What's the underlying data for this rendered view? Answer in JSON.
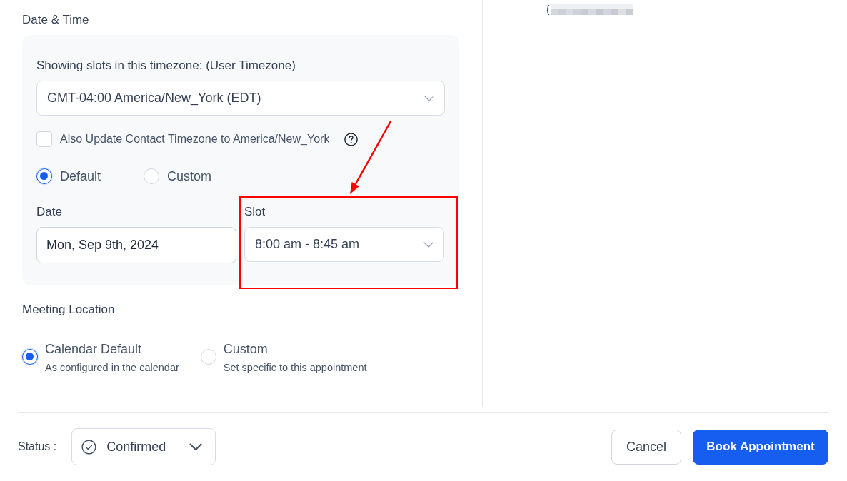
{
  "date_time": {
    "heading": "Date & Time",
    "timezone": {
      "label": "Showing slots in this timezone: (User Timezone)",
      "value": "GMT-04:00 America/New_York (EDT)"
    },
    "update_contact_timezone": {
      "label": "Also Update Contact Timezone to America/New_York",
      "checked": false
    },
    "slot_mode": [
      {
        "label": "Default",
        "selected": true
      },
      {
        "label": "Custom",
        "selected": false
      }
    ],
    "date": {
      "label": "Date",
      "value": "Mon, Sep 9th, 2024"
    },
    "slot": {
      "label": "Slot",
      "value": "8:00 am - 8:45 am",
      "highlighted": true
    }
  },
  "meeting_location": {
    "heading": "Meeting Location",
    "options": [
      {
        "title": "Calendar Default",
        "description": "As configured in the calendar",
        "selected": true
      },
      {
        "title": "Custom",
        "description": "Set specific to this appointment",
        "selected": false
      }
    ]
  },
  "side_panel": {
    "text": "("
  },
  "footer": {
    "status_label": "Status :",
    "status": "Confirmed",
    "buttons": [
      {
        "label": "Cancel",
        "kind": "secondary"
      },
      {
        "label": "Book Appointment",
        "kind": "primary"
      }
    ]
  }
}
